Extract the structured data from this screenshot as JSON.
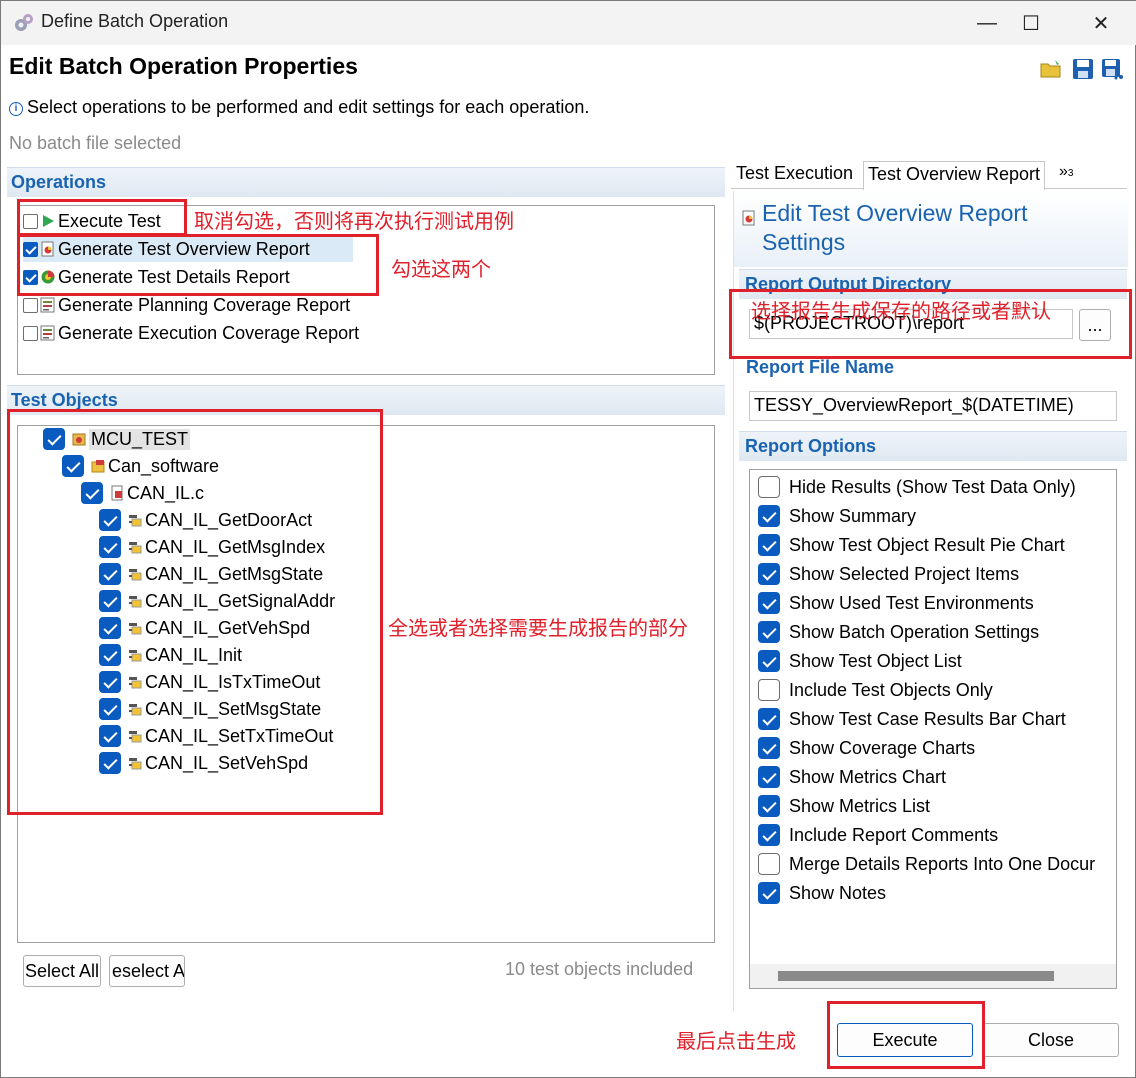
{
  "window": {
    "title": "Define Batch Operation",
    "minimize": "—",
    "maximize": "☐",
    "close": "✕"
  },
  "header": {
    "title": "Edit Batch Operation Properties",
    "info": "Select operations to be performed and edit settings for each operation.",
    "batch_status": "No batch file selected"
  },
  "operations": {
    "heading": "Operations",
    "items": [
      {
        "label": "Execute Test",
        "checked": false
      },
      {
        "label": "Generate Test Overview Report",
        "checked": true
      },
      {
        "label": "Generate Test Details Report",
        "checked": true
      },
      {
        "label": "Generate Planning Coverage Report",
        "checked": false
      },
      {
        "label": "Generate Execution Coverage Report",
        "checked": false
      }
    ]
  },
  "test_objects": {
    "heading": "Test Objects",
    "tree": [
      {
        "label": "MCU_TEST",
        "checked": true
      },
      {
        "label": "Can_software",
        "checked": true
      },
      {
        "label": "CAN_IL.c",
        "checked": true
      },
      {
        "label": "CAN_IL_GetDoorAct",
        "checked": true
      },
      {
        "label": "CAN_IL_GetMsgIndex",
        "checked": true
      },
      {
        "label": "CAN_IL_GetMsgState",
        "checked": true
      },
      {
        "label": "CAN_IL_GetSignalAddr",
        "checked": true
      },
      {
        "label": "CAN_IL_GetVehSpd",
        "checked": true
      },
      {
        "label": "CAN_IL_Init",
        "checked": true
      },
      {
        "label": "CAN_IL_IsTxTimeOut",
        "checked": true
      },
      {
        "label": "CAN_IL_SetMsgState",
        "checked": true
      },
      {
        "label": "CAN_IL_SetTxTimeOut",
        "checked": true
      },
      {
        "label": "CAN_IL_SetVehSpd",
        "checked": true
      }
    ],
    "select_all": "Select All",
    "deselect_all": "eselect A",
    "count_text": "10 test objects included"
  },
  "tabs": {
    "items": [
      "Test Execution",
      "Test Overview Report"
    ],
    "overflow": "»",
    "overflow_count": "3"
  },
  "report_settings": {
    "title_line1": "Edit Test Overview Report",
    "title_line2": "Settings",
    "output_dir_label": "Report Output Directory",
    "output_dir_value": "$(PROJECTROOT)\\report",
    "browse": "...",
    "file_name_label": "Report File Name",
    "file_name_value": "TESSY_OverviewReport_$(DATETIME)",
    "options_label": "Report Options",
    "options": [
      {
        "label": "Hide Results (Show Test Data Only)",
        "checked": false
      },
      {
        "label": "Show Summary",
        "checked": true
      },
      {
        "label": "Show Test Object Result Pie Chart",
        "checked": true
      },
      {
        "label": "Show Selected Project Items",
        "checked": true
      },
      {
        "label": "Show Used Test Environments",
        "checked": true
      },
      {
        "label": "Show Batch Operation Settings",
        "checked": true
      },
      {
        "label": "Show Test Object List",
        "checked": true
      },
      {
        "label": "Include Test Objects Only",
        "checked": false
      },
      {
        "label": "Show Test Case Results Bar Chart",
        "checked": true
      },
      {
        "label": "Show Coverage Charts",
        "checked": true
      },
      {
        "label": "Show Metrics Chart",
        "checked": true
      },
      {
        "label": "Show Metrics List",
        "checked": true
      },
      {
        "label": "Include Report Comments",
        "checked": true
      },
      {
        "label": "Merge Details Reports Into One Docur",
        "checked": false
      },
      {
        "label": "Show Notes",
        "checked": true
      }
    ]
  },
  "footer": {
    "execute": "Execute",
    "close": "Close"
  },
  "annotations": {
    "uncheck_note": "取消勾选，否则将再次执行测试用例",
    "check_two_note": "勾选这两个",
    "path_note": "选择报告生成保存的路径或者默认",
    "select_note": "全选或者选择需要生成报告的部分",
    "final_note": "最后点击生成"
  },
  "colors": {
    "accent": "#0a5bbf",
    "section_heading": "#1a63b0",
    "annotation_red": "#e0202a"
  }
}
